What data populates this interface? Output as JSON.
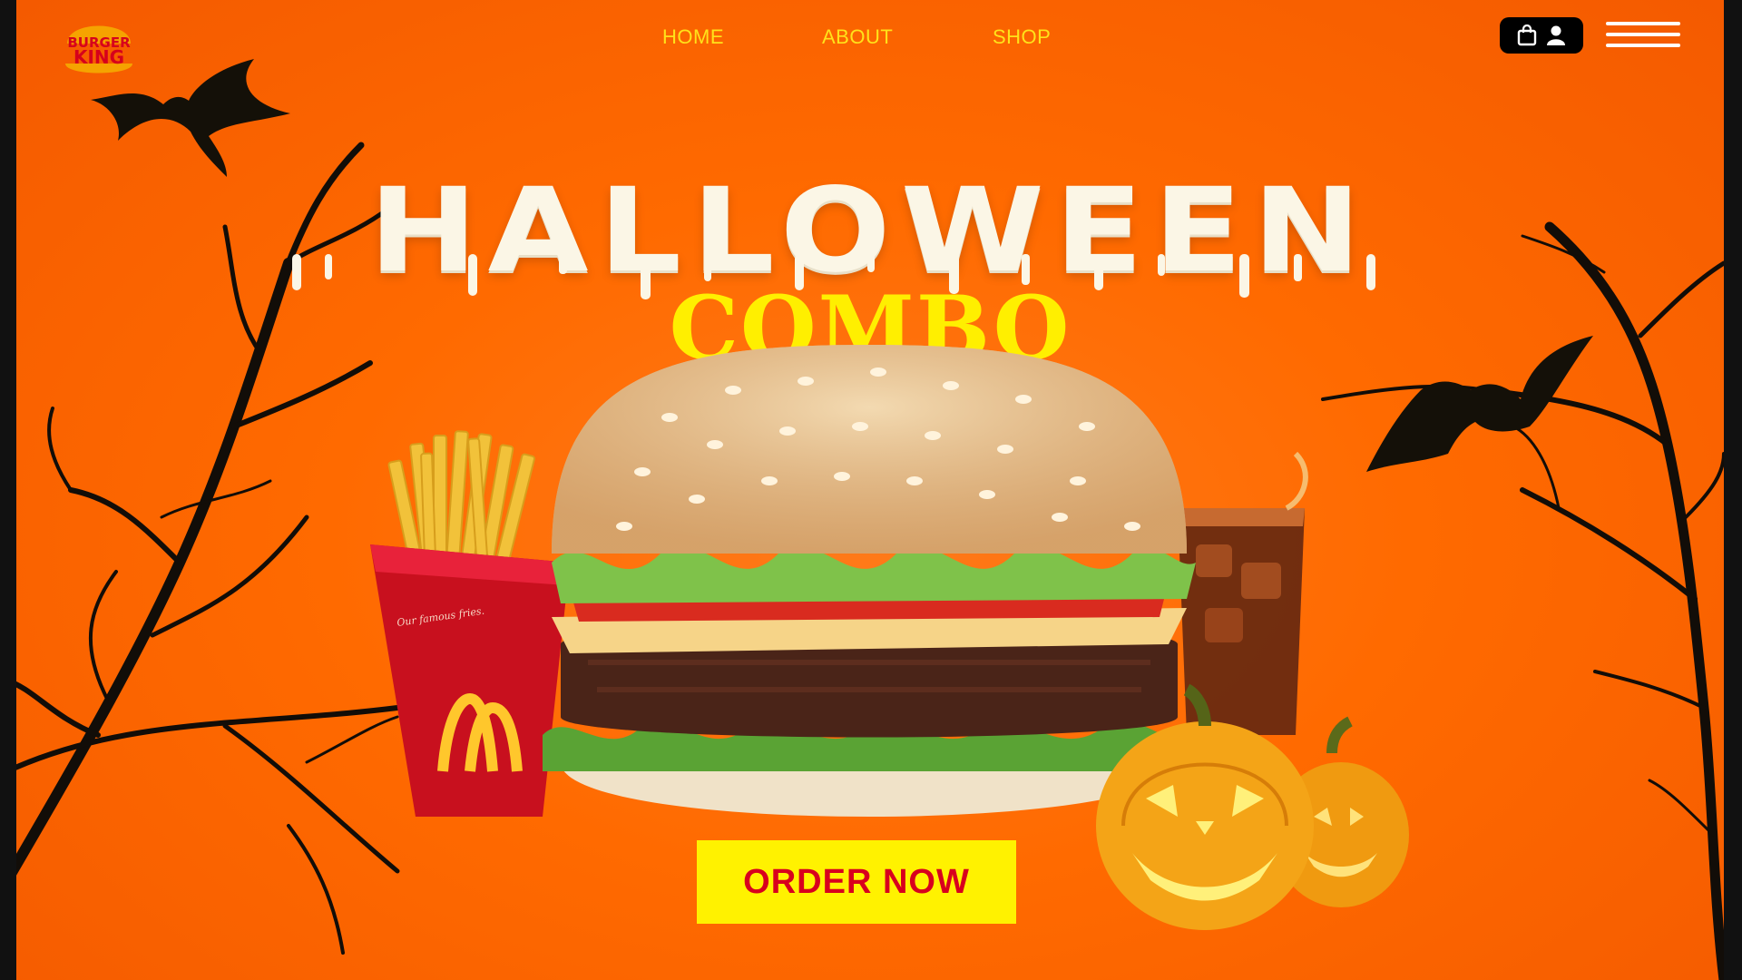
{
  "brand": {
    "logo_top": "BURGER",
    "logo_bottom": "KING"
  },
  "nav": {
    "items": [
      {
        "label": "HOME"
      },
      {
        "label": "ABOUT"
      },
      {
        "label": "SHOP"
      }
    ]
  },
  "header_actions": {
    "icons": [
      "shopping-bag-icon",
      "user-icon",
      "hamburger-menu-icon"
    ]
  },
  "hero": {
    "headline": "HALLOWEEN",
    "subheadline": "COMBO",
    "cta_label": "ORDER NOW",
    "fries_box_text": "Our famous fries."
  },
  "colors": {
    "background": "#ff6a00",
    "nav_text": "#ffe21a",
    "headline": "#fbf6e6",
    "subheadline": "#ffef00",
    "cta_bg": "#fff200",
    "cta_text": "#d8001e"
  }
}
